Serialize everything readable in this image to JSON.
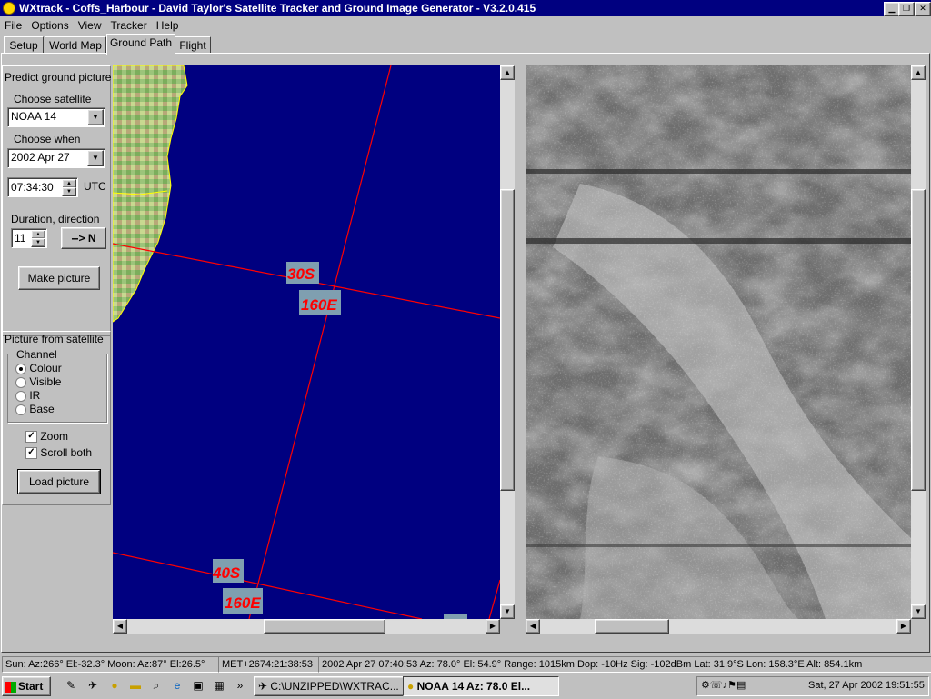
{
  "window": {
    "title": "WXtrack - Coffs_Harbour - David Taylor's Satellite Tracker and Ground Image Generator - V3.2.0.415",
    "min_icon": "minimize-icon",
    "max_icon": "restore-icon",
    "close_icon": "close-icon"
  },
  "menu": [
    "File",
    "Options",
    "View",
    "Tracker",
    "Help"
  ],
  "tabs": [
    "Setup",
    "World Map",
    "Ground Path",
    "Flight"
  ],
  "active_tab": "Ground Path",
  "predict": {
    "heading": "Predict ground picture",
    "choose_satellite_label": "Choose satellite",
    "satellite": "NOAA 14",
    "choose_when_label": "Choose when",
    "date": "2002 Apr 27",
    "time": "07:34:30",
    "utc_label": "UTC",
    "duration_label": "Duration, direction",
    "duration": "11",
    "direction_button": "--> N",
    "make_picture_button": "Make picture"
  },
  "picture_from_satellite": {
    "heading": "Picture from satellite",
    "channel_label": "Channel",
    "channels": [
      "Colour",
      "Visible",
      "IR",
      "Base"
    ],
    "selected_channel": "Colour",
    "zoom_label": "Zoom",
    "zoom_checked": true,
    "scroll_both_label": "Scroll both",
    "scroll_both_checked": true,
    "load_picture_button": "Load picture"
  },
  "map": {
    "ocean_color": "#000080",
    "grid_color": "#ff0000",
    "labels": {
      "lat30": "30S",
      "lon160a": "160E",
      "lat40": "40S",
      "lon160b": "160E"
    }
  },
  "status": {
    "sun_moon": "Sun: Az:266° El:-32.3°  Moon: Az:87° El:26.5°",
    "met": "MET+2674:21:38:53",
    "pass": "2002 Apr 27  07:40:53  Az: 78.0°  El: 54.9°  Range: 1015km  Dop: -10Hz  Sig: -102dBm  Lat: 31.9°S  Lon: 158.3°E  Alt: 854.1km"
  },
  "taskbar": {
    "start_label": "Start",
    "task1": "C:\\UNZIPPED\\WXTRAC...",
    "task2": "NOAA 14  Az: 78.0 El...",
    "clock": "Sat, 27 Apr 2002  19:51:55",
    "quicklaunch_more": "»"
  }
}
